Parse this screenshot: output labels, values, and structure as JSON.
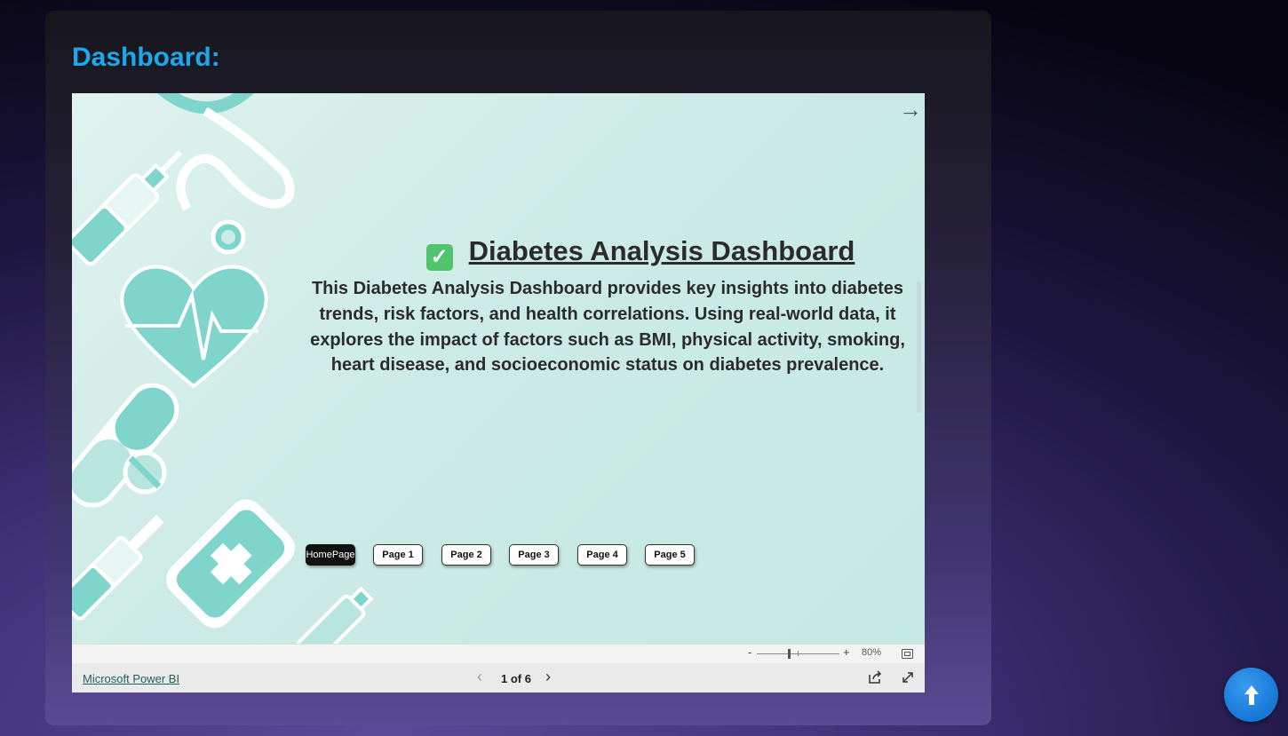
{
  "section": {
    "title": "Dashboard:"
  },
  "report": {
    "title": "Diabetes Analysis Dashboard",
    "description": "This Diabetes Analysis Dashboard provides key insights into diabetes trends, risk factors, and health correlations. Using real-world data, it explores the impact of factors such as BMI, physical activity, smoking, heart disease, and socioeconomic status on diabetes prevalence.",
    "nav_buttons": [
      "HomePage",
      "Page 1",
      "Page 2",
      "Page 3",
      "Page 4",
      "Page 5"
    ],
    "active_button": "HomePage"
  },
  "zoom": {
    "minus": "-",
    "plus": "+",
    "level": "80%",
    "value_percent": 80
  },
  "footer": {
    "brand_link": "Microsoft Power BI",
    "pager": "1 of 6",
    "current_page": 1,
    "total_pages": 6
  },
  "colors": {
    "accent": "#1aa9ea",
    "report_bg": "#cdebe6",
    "medical_teal": "#7fd5cb",
    "scroll_button": "#1677d6"
  },
  "icons": {
    "next_page": "arrow-right-icon",
    "title_check": "check-icon",
    "share": "share-icon",
    "fullscreen": "expand-icon",
    "fit_to_page": "fit-page-icon",
    "scroll_top": "arrow-up-icon"
  }
}
